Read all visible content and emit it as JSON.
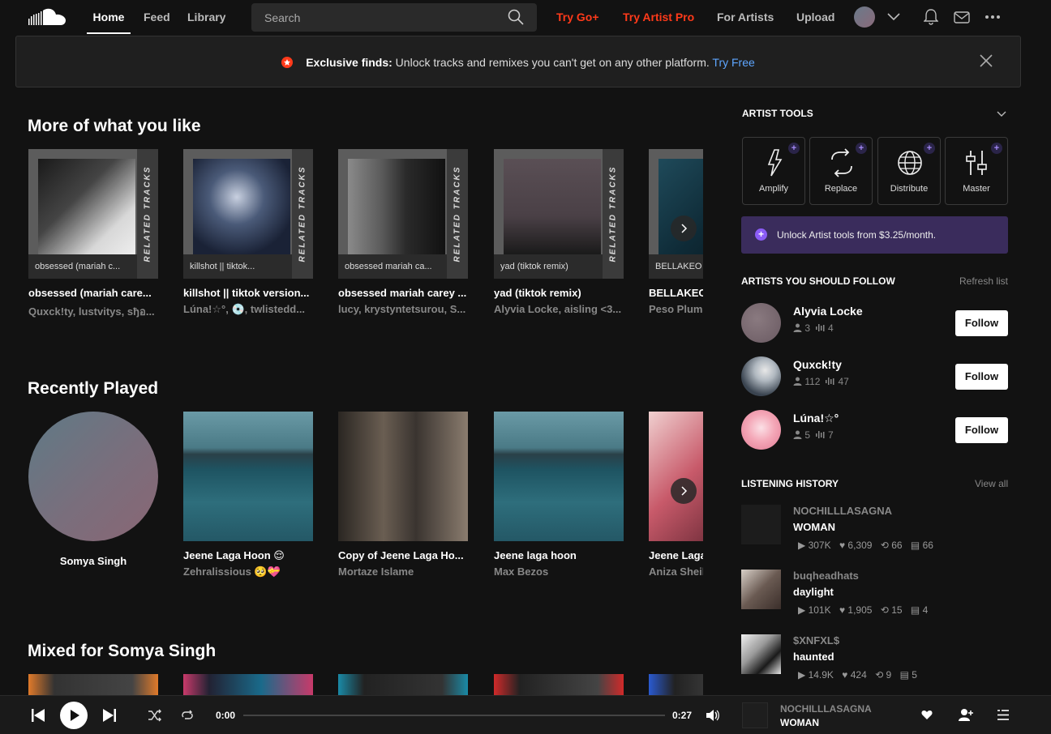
{
  "nav": {
    "tabs": [
      "Home",
      "Feed",
      "Library"
    ],
    "search_placeholder": "Search",
    "try_go": "Try Go+",
    "try_artist_pro": "Try Artist Pro",
    "for_artists": "For Artists",
    "upload": "Upload"
  },
  "banner": {
    "bold": "Exclusive finds:",
    "text": " Unlock tracks and remixes you can't get on any other platform. ",
    "link": "Try Free"
  },
  "more_like": {
    "title": "More of what you like",
    "related_label": "RELATED TRACKS",
    "cards": [
      {
        "caption": "obsessed (mariah c...",
        "title": "obsessed (mariah care...",
        "sub": "Quxck!ty, lustvitys, ѕђอ..."
      },
      {
        "caption": "killshot || tiktok...",
        "title": "killshot || tiktok version...",
        "sub": "Lúna!☆°, 💿, twlistedd..."
      },
      {
        "caption": "obsessed mariah ca...",
        "title": "obsessed mariah carey ...",
        "sub": "lucy, krystyntetsurou, S..."
      },
      {
        "caption": "yad (tiktok remix)",
        "title": "yad (tiktok remix)",
        "sub": "Alyvia Locke, aisling <3..."
      },
      {
        "caption": "BELLAKEO",
        "title": "BELLAKEO",
        "sub": "Peso Pluma"
      }
    ]
  },
  "recently_played": {
    "title": "Recently Played",
    "cards": [
      {
        "title": "Somya Singh",
        "sub": ""
      },
      {
        "title": "Jeene Laga Hoon 😌",
        "sub": "Zehralissious 🥺💝"
      },
      {
        "title": "Copy of Jeene Laga Ho...",
        "sub": "Mortaze Islame"
      },
      {
        "title": "Jeene laga hoon",
        "sub": "Max Bezos"
      },
      {
        "title": "Jeene Laga",
        "sub": "Aniza Sheikh"
      }
    ]
  },
  "mixed": {
    "title": "Mixed for Somya Singh"
  },
  "artist_tools": {
    "title": "ARTIST TOOLS",
    "tools": [
      "Amplify",
      "Replace",
      "Distribute",
      "Master"
    ],
    "unlock": "Unlock Artist tools from $3.25/month."
  },
  "follow": {
    "title": "ARTISTS YOU SHOULD FOLLOW",
    "refresh": "Refresh list",
    "button": "Follow",
    "artists": [
      {
        "name": "Alyvia Locke",
        "followers": "3",
        "tracks": "4"
      },
      {
        "name": "Quxck!ty",
        "followers": "112",
        "tracks": "47"
      },
      {
        "name": "Lúna!☆°",
        "followers": "5",
        "tracks": "7"
      }
    ]
  },
  "history": {
    "title": "LISTENING HISTORY",
    "view_all": "View all",
    "items": [
      {
        "artist": "NOCHILLLASAGNA",
        "title": "WOMAN",
        "plays": "307K",
        "likes": "6,309",
        "reposts": "66",
        "comments": "66"
      },
      {
        "artist": "buqheadhats",
        "title": "daylight",
        "plays": "101K",
        "likes": "1,905",
        "reposts": "15",
        "comments": "4"
      },
      {
        "artist": "$XNFXL$",
        "title": "haunted",
        "plays": "14.9K",
        "likes": "424",
        "reposts": "9",
        "comments": "5"
      }
    ]
  },
  "player": {
    "elapsed": "0:00",
    "duration": "0:27",
    "progress": 0,
    "artist": "NOCHILLLASAGNA",
    "title": "WOMAN"
  },
  "colors": {
    "accent": "#ff5500",
    "promo": "#ff3a1a",
    "link": "#5ea6ff",
    "purple": "#3a2c5c"
  }
}
